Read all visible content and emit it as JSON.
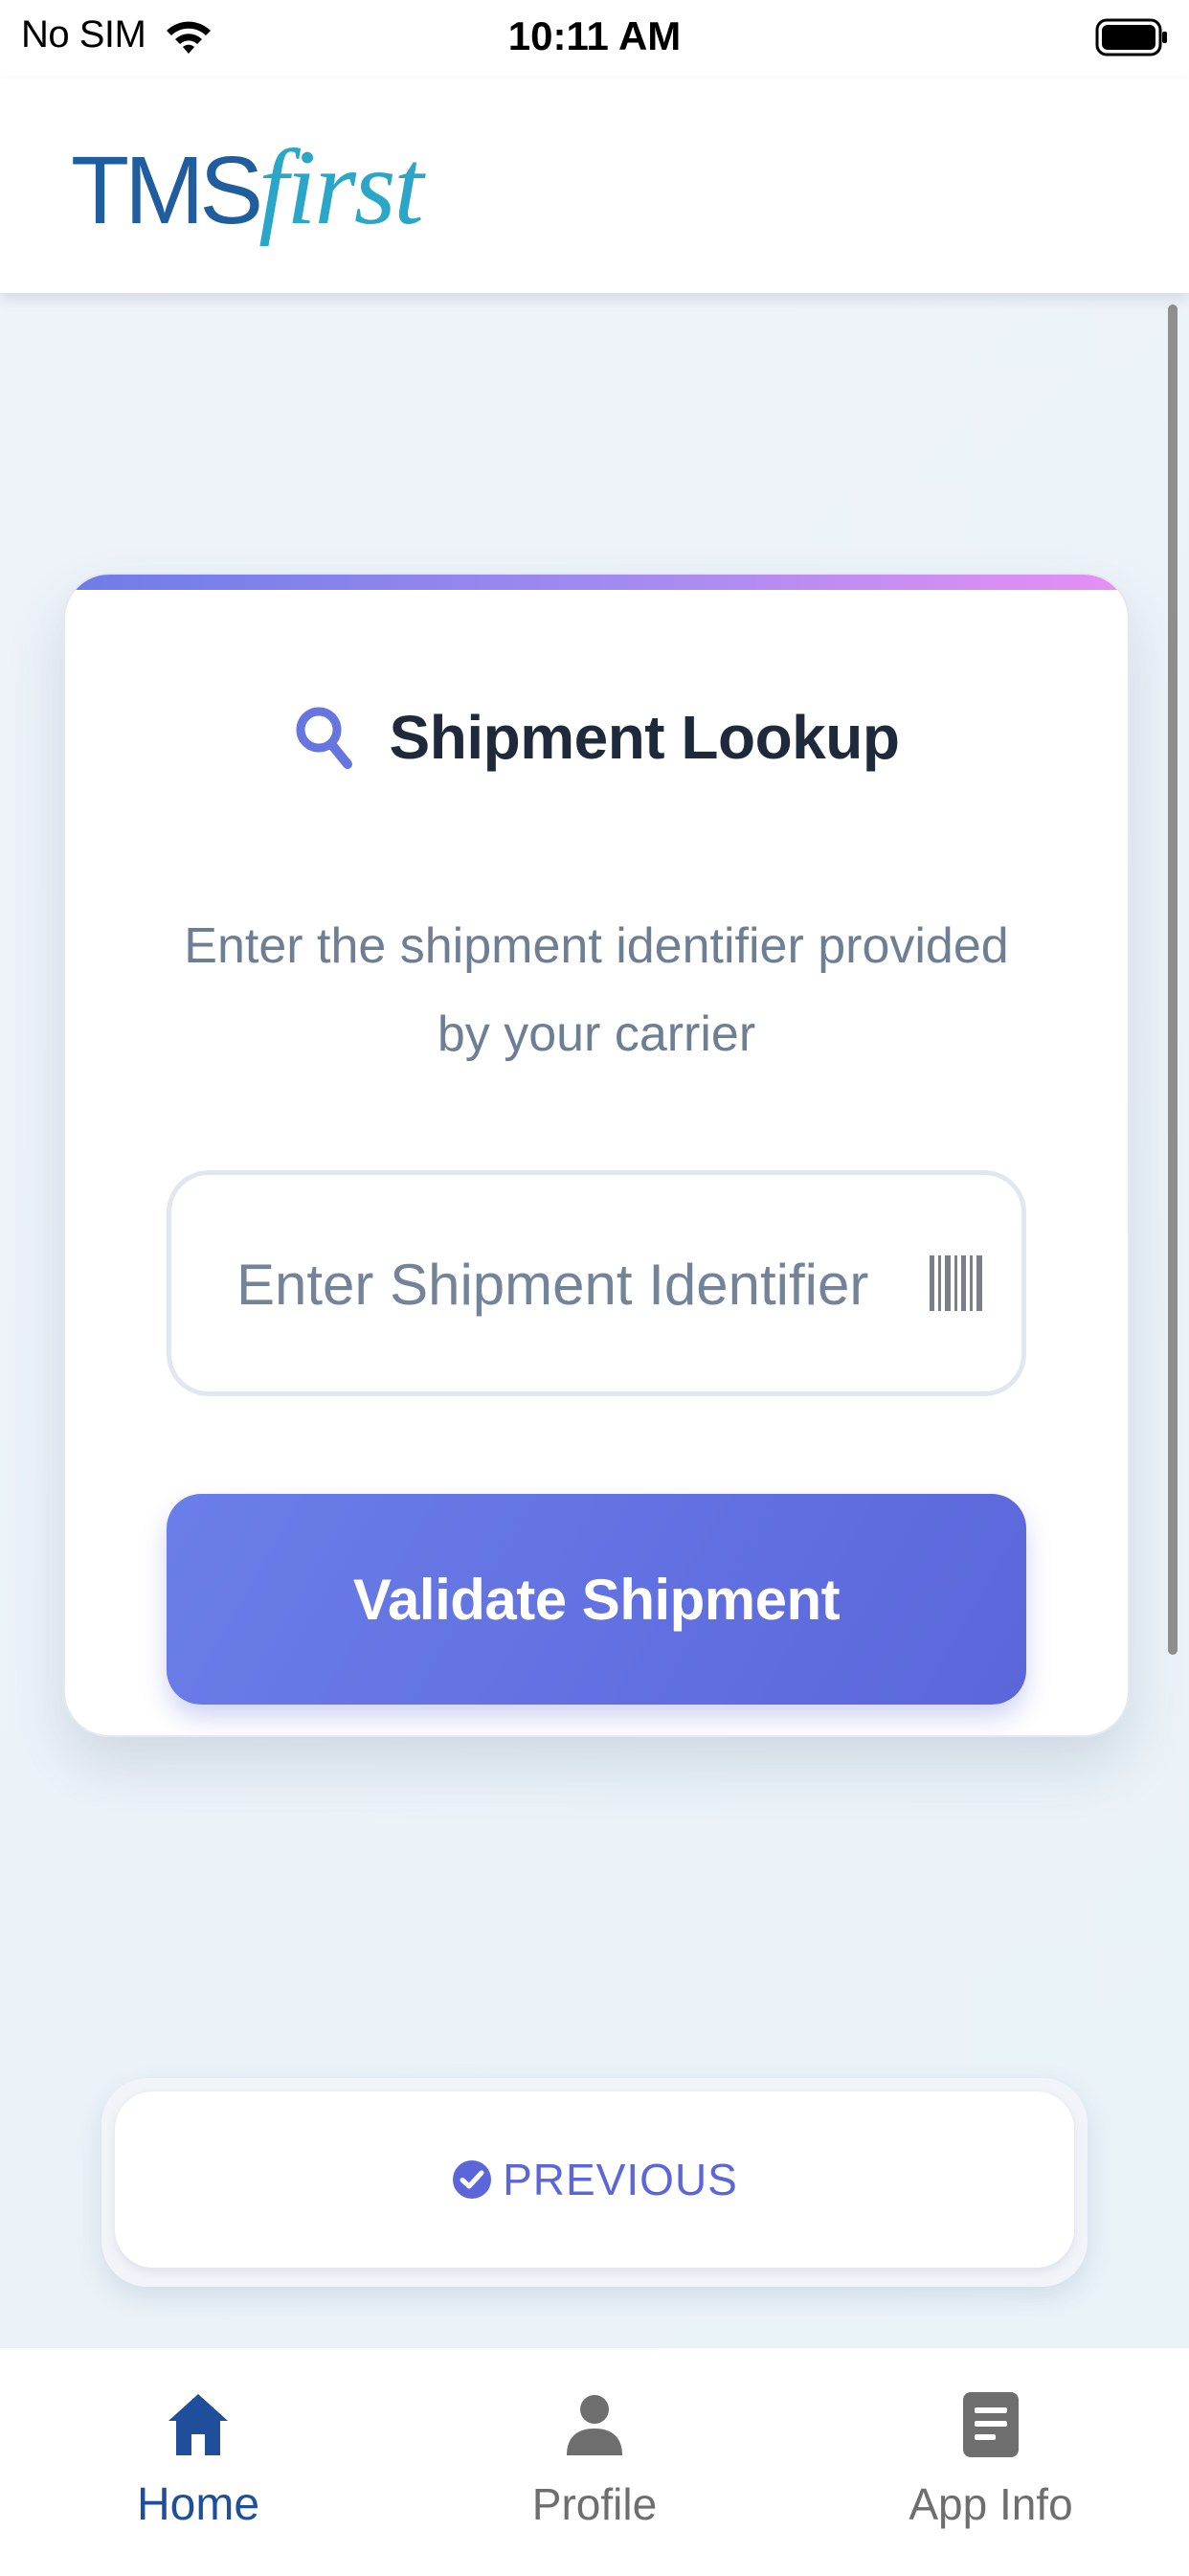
{
  "status_bar": {
    "carrier": "No SIM",
    "time": "10:11 AM"
  },
  "header": {
    "logo_part1": "TMS",
    "logo_part2": "first"
  },
  "lookup_card": {
    "title": "Shipment Lookup",
    "subtitle": "Enter the shipment identifier provided by your carrier",
    "input_placeholder": "Enter Shipment Identifier",
    "input_value": "",
    "validate_button_label": "Validate Shipment"
  },
  "previous": {
    "label": "PREVIOUS"
  },
  "tab_bar": {
    "tabs": [
      {
        "label": "Home",
        "icon": "home-icon",
        "active": true
      },
      {
        "label": "Profile",
        "icon": "person-icon",
        "active": false
      },
      {
        "label": "App Info",
        "icon": "document-icon",
        "active": false
      }
    ]
  },
  "colors": {
    "primary": "#5b66da",
    "brand_blue": "#1f5d9e",
    "brand_teal": "#2aa6c9",
    "active_tab": "#1f4f9a",
    "inactive_tab": "#6e6e6e"
  }
}
